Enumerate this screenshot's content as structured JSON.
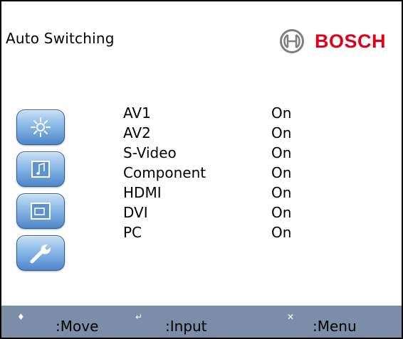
{
  "window": {
    "title": "Auto Switching"
  },
  "brand": {
    "name": "BOSCH"
  },
  "toolbar": {
    "items": [
      {
        "icon": "brightness-icon"
      },
      {
        "icon": "audio-icon"
      },
      {
        "icon": "display-icon"
      },
      {
        "icon": "wrench-icon"
      }
    ]
  },
  "settings": {
    "rows": [
      {
        "label": "AV1",
        "value": "On"
      },
      {
        "label": "AV2",
        "value": "On"
      },
      {
        "label": "S-Video",
        "value": "On"
      },
      {
        "label": "Component",
        "value": "On"
      },
      {
        "label": "HDMI",
        "value": "On"
      },
      {
        "label": "DVI",
        "value": "On"
      },
      {
        "label": "PC",
        "value": "On"
      }
    ]
  },
  "footer": {
    "move": {
      "icon_glyph": "♦",
      "label": ":Move"
    },
    "input": {
      "icon_glyph": "↵",
      "label": ":Input"
    },
    "menu": {
      "icon_glyph": "✕",
      "label": ":Menu"
    }
  }
}
